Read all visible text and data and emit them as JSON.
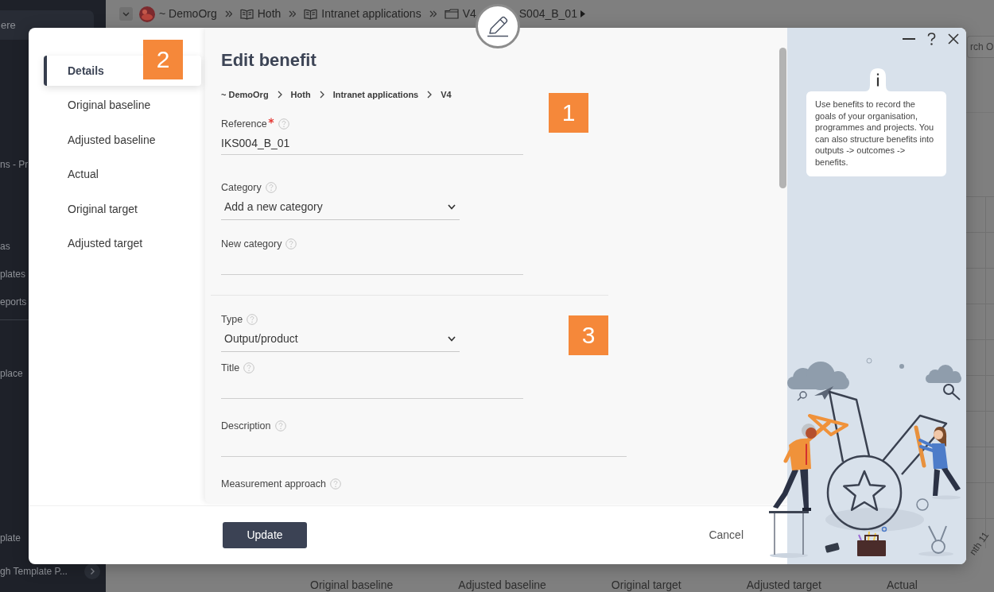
{
  "sidebar": {
    "search": {
      "placeholder": "ere"
    },
    "items": [
      {
        "label": "ns - Pr"
      },
      {
        "label": "as"
      },
      {
        "label": "plates"
      },
      {
        "label": "eports"
      },
      {
        "label": "place"
      },
      {
        "label": "plate"
      },
      {
        "label": "gh Template P..."
      }
    ]
  },
  "top_bar": {
    "breadcrumb": [
      {
        "kind": "org",
        "label": "~ DemoOrg"
      },
      {
        "kind": "project",
        "label": "Hoth"
      },
      {
        "kind": "project",
        "label": "Intranet applications"
      },
      {
        "kind": "version",
        "label": "V4"
      }
    ],
    "trailing_text": "S004_B_01"
  },
  "page_search": {
    "placeholder": "rch O"
  },
  "chart_background": {
    "axis_label": "nth 11",
    "legend": [
      "Original baseline",
      "Adjusted baseline",
      "Original target",
      "Adjusted target",
      "Actual"
    ]
  },
  "dialog": {
    "nav": {
      "callout": "2",
      "items": [
        {
          "label": "Details",
          "selected": true
        },
        {
          "label": "Original baseline",
          "selected": false
        },
        {
          "label": "Adjusted baseline",
          "selected": false
        },
        {
          "label": "Actual",
          "selected": false
        },
        {
          "label": "Original target",
          "selected": false
        },
        {
          "label": "Adjusted target",
          "selected": false
        }
      ]
    },
    "title": "Edit benefit",
    "breadcrumb": [
      "~ DemoOrg",
      "Hoth",
      "Intranet applications",
      "V4"
    ],
    "sections": [
      {
        "callout": "1",
        "fields": [
          {
            "kind": "text",
            "label": "Reference",
            "required": true,
            "value": "IKS004_B_01"
          },
          {
            "kind": "select",
            "label": "Category",
            "required": false,
            "value": "Add a new category"
          },
          {
            "kind": "text",
            "label": "New category",
            "required": false
          }
        ]
      },
      {
        "callout": "3",
        "fields": [
          {
            "kind": "select",
            "label": "Type",
            "required": false,
            "value": "Output/product"
          },
          {
            "kind": "text",
            "label": "Title",
            "required": false
          },
          {
            "kind": "textarea",
            "label": "Description",
            "required": false
          },
          {
            "kind": "label",
            "label": "Measurement approach",
            "required": false
          }
        ]
      }
    ],
    "actions": [
      {
        "kind": "primary",
        "label": "Update"
      },
      {
        "kind": "link",
        "label": "Cancel"
      }
    ],
    "info": {
      "text": "Use benefits to record the goals of your organisation, programmes and projects. You can also structure benefits into outputs -> outcomes -> benefits."
    }
  }
}
